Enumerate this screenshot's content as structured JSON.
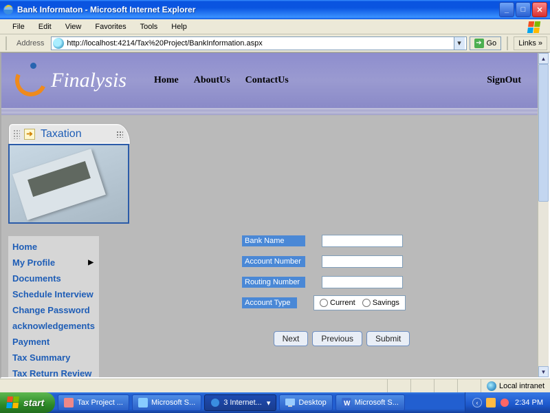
{
  "window": {
    "title": "Bank Informaton - Microsoft Internet Explorer"
  },
  "menu": {
    "file": "File",
    "edit": "Edit",
    "view": "View",
    "favorites": "Favorites",
    "tools": "Tools",
    "help": "Help"
  },
  "address": {
    "label": "Address",
    "url": "http://localhost:4214/Tax%20Project/BankInformation.aspx",
    "go": "Go",
    "links": "Links"
  },
  "banner": {
    "logo_text": "Finalysis",
    "nav_home": "Home",
    "nav_about": "AboutUs",
    "nav_contact": "ContactUs",
    "signout": "SignOut"
  },
  "sidebar": {
    "heading": "Taxation",
    "items": {
      "home": "Home",
      "profile": "My Profile",
      "documents": "Documents",
      "schedule": "Schedule Interview",
      "changepw": "Change Password",
      "ack": "acknowledgements",
      "payment": "Payment",
      "taxsum": "Tax Summary",
      "taxret": "Tax Return Review"
    }
  },
  "form": {
    "bank_name_label": "Bank Name",
    "account_number_label": "Account Number",
    "routing_number_label": "Routing Number",
    "account_type_label": "Account Type",
    "radio_current": "Current",
    "radio_savings": "Savings",
    "btn_next": "Next",
    "btn_previous": "Previous",
    "btn_submit": "Submit",
    "bank_name_value": "",
    "account_number_value": "",
    "routing_number_value": ""
  },
  "status": {
    "zone": "Local intranet"
  },
  "taskbar": {
    "start": "start",
    "items": {
      "taxproj": "Tax Project ...",
      "mss1": "Microsoft S...",
      "ie": "3 Internet...",
      "desktop": "Desktop",
      "mss2": "Microsoft S..."
    },
    "clock": "2:34 PM"
  }
}
